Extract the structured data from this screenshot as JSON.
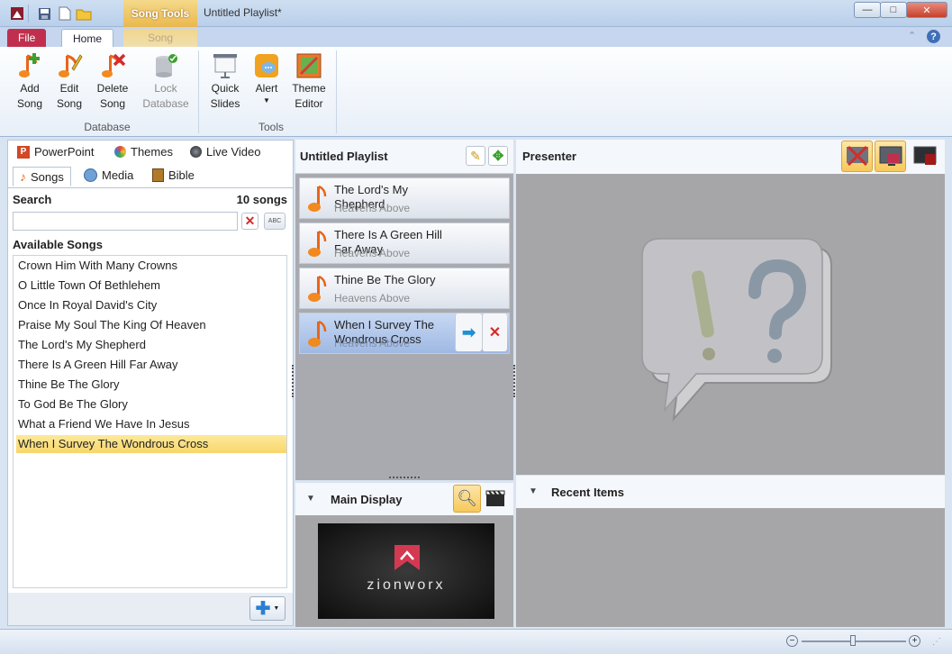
{
  "window": {
    "title": "Untitled Playlist*",
    "context_tab_group": "Song Tools",
    "minimize": "—",
    "maximize": "□",
    "close": "✕"
  },
  "ribbon": {
    "tabs": {
      "file": "File",
      "home": "Home",
      "song": "Song"
    },
    "database": {
      "label": "Database",
      "add_song": [
        "Add",
        "Song"
      ],
      "edit_song": [
        "Edit",
        "Song"
      ],
      "delete_song": [
        "Delete",
        "Song"
      ],
      "lock_database": [
        "Lock",
        "Database"
      ]
    },
    "tools": {
      "label": "Tools",
      "quick_slides": [
        "Quick",
        "Slides"
      ],
      "alert": "Alert",
      "theme_editor": [
        "Theme",
        "Editor"
      ]
    }
  },
  "left_panel": {
    "source_tabs": {
      "powerpoint": "PowerPoint",
      "themes": "Themes",
      "live_video": "Live Video",
      "songs": "Songs",
      "media": "Media",
      "bible": "Bible"
    },
    "search_label": "Search",
    "song_count": "10 songs",
    "search_value": "",
    "available_label": "Available Songs",
    "songs": [
      "Crown Him With Many Crowns",
      "O Little Town Of Bethlehem",
      "Once In Royal David's City",
      "Praise My Soul The King Of Heaven",
      "The Lord's My Shepherd",
      "There Is A Green Hill Far Away",
      "Thine Be The Glory",
      "To God Be The Glory",
      "What a Friend We Have In Jesus",
      "When I Survey The Wondrous Cross"
    ],
    "selected_song": "When I Survey The Wondrous Cross"
  },
  "playlist": {
    "title": "Untitled Playlist",
    "items": [
      {
        "title": "The Lord's My Shepherd",
        "subtitle": "Heavens Above"
      },
      {
        "title": "There Is A Green Hill Far Away",
        "subtitle": "Heavens Above"
      },
      {
        "title": "Thine Be The Glory",
        "subtitle": "Heavens Above"
      },
      {
        "title": "When I Survey The Wondrous Cross",
        "subtitle": "Heavens Above"
      }
    ]
  },
  "main_display": {
    "label": "Main Display",
    "logo_text": "zionworx"
  },
  "presenter": {
    "label": "Presenter"
  },
  "recent": {
    "label": "Recent Items"
  },
  "colors": {
    "accent": "#c0304e",
    "selection": "#f8d66a",
    "context": "#e9b84e"
  }
}
